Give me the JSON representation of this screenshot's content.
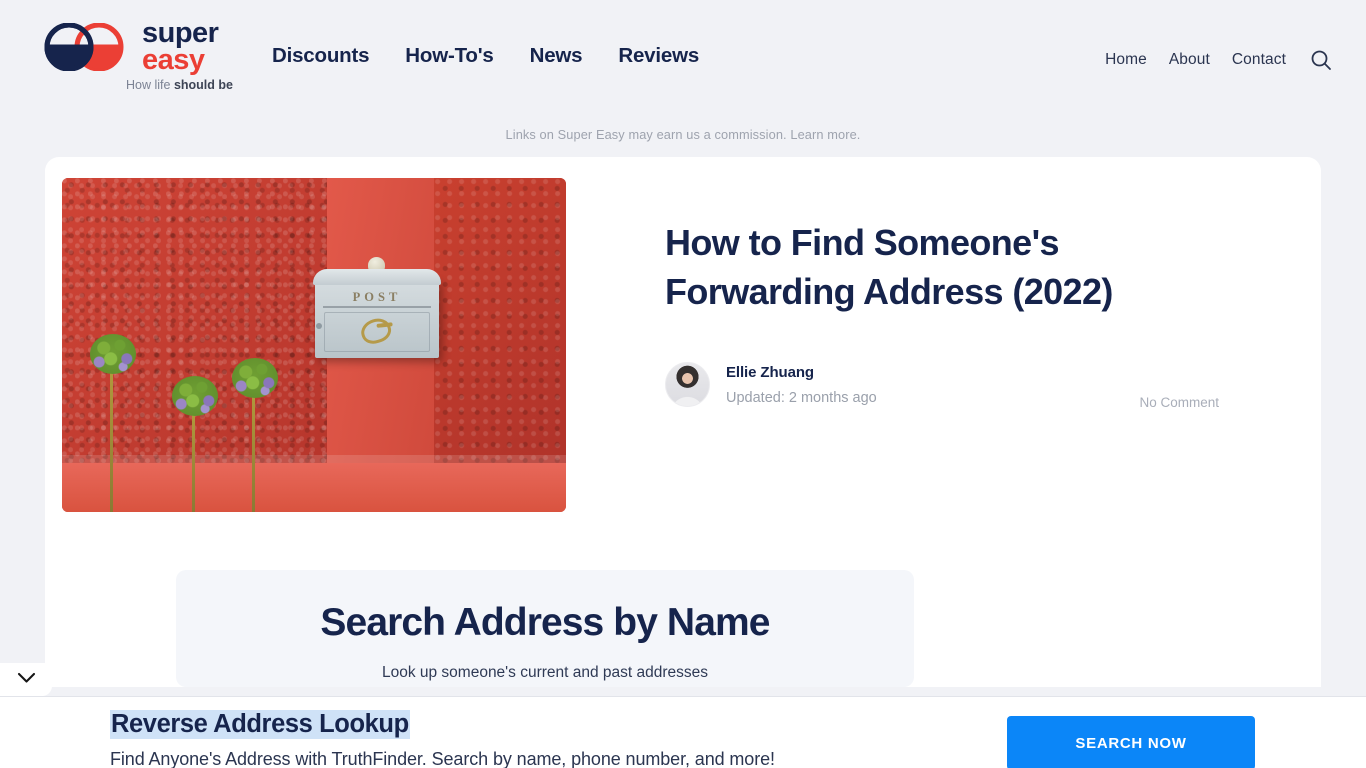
{
  "header": {
    "logo": {
      "word_top": "super",
      "word_bottom": "easy",
      "tagline_prefix": "How life ",
      "tagline_bold": "should be",
      "navy": "#16244c",
      "red": "#eb3f35"
    },
    "main_nav": [
      {
        "label": "Discounts"
      },
      {
        "label": "How-To's"
      },
      {
        "label": "News"
      },
      {
        "label": "Reviews"
      }
    ],
    "util_nav": [
      {
        "label": "Home"
      },
      {
        "label": "About"
      },
      {
        "label": "Contact"
      }
    ],
    "search_icon": "search-icon"
  },
  "disclaimer": "Links on Super Easy may earn us a commission. Learn more.",
  "article": {
    "title": "How to Find Someone's Forwarding Address (2022)",
    "hero_alt": "white POST mailbox on red textured wall with allium flowers",
    "mailbox_label": "POST",
    "author": "Ellie Zhuang",
    "updated": "Updated: 2 months ago",
    "comments": "No Comment"
  },
  "search_widget": {
    "title": "Search Address by Name",
    "subtitle": "Look up someone's current and past addresses"
  },
  "collapse_tab": {
    "icon": "chevron-down-icon"
  },
  "bottom_ad": {
    "headline": "Reverse Address Lookup",
    "subtext": "Find Anyone's Address with TruthFinder. Search by name, phone number, and more!",
    "cta_label": "SEARCH NOW",
    "cta_color": "#0b86f8",
    "highlight_color": "#cfe2f7"
  }
}
